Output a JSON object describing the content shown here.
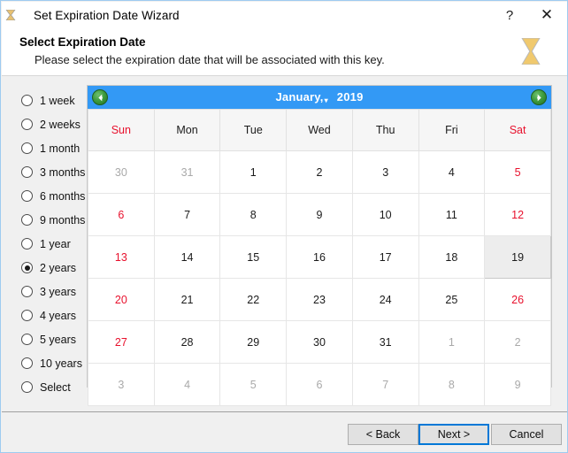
{
  "window": {
    "title": "Set Expiration Date Wizard",
    "title_icon": "hourglass-icon",
    "help_label": "?",
    "close_label": "✕",
    "border_color": "#9ecbf0",
    "background": "#f0f0f0"
  },
  "header": {
    "title": "Select Expiration Date",
    "subtitle": "Please select the expiration date that will be associated with this key.",
    "icon": "hourglass-icon"
  },
  "expiration_options": {
    "selected": "2 years",
    "items": [
      {
        "label": "1 week",
        "checked": false
      },
      {
        "label": "2 weeks",
        "checked": false
      },
      {
        "label": "1 month",
        "checked": false
      },
      {
        "label": "3 months",
        "checked": false
      },
      {
        "label": "6 months",
        "checked": false
      },
      {
        "label": "9 months",
        "checked": false
      },
      {
        "label": "1 year",
        "checked": false
      },
      {
        "label": "2 years",
        "checked": true
      },
      {
        "label": "3 years",
        "checked": false
      },
      {
        "label": "4 years",
        "checked": false
      },
      {
        "label": "5 years",
        "checked": false
      },
      {
        "label": "10 years",
        "checked": false
      },
      {
        "label": "Select",
        "checked": false
      }
    ]
  },
  "calendar": {
    "month_label": "January,",
    "year_label": "2019",
    "month": "January",
    "year": "2019",
    "prev_icon": "arrow-left-circle-icon",
    "next_icon": "arrow-right-circle-icon",
    "header_color": "#3399f5",
    "weekend_color": "#e8112d",
    "selected_day": "19",
    "selected_date": "2019-01-19",
    "weekdays": [
      {
        "label": "Sun",
        "weekend": true
      },
      {
        "label": "Mon",
        "weekend": false
      },
      {
        "label": "Tue",
        "weekend": false
      },
      {
        "label": "Wed",
        "weekend": false
      },
      {
        "label": "Thu",
        "weekend": false
      },
      {
        "label": "Fri",
        "weekend": false
      },
      {
        "label": "Sat",
        "weekend": true
      }
    ],
    "weeks": [
      [
        {
          "day": "30",
          "type": "other"
        },
        {
          "day": "31",
          "type": "other"
        },
        {
          "day": "1",
          "type": "normal"
        },
        {
          "day": "2",
          "type": "normal"
        },
        {
          "day": "3",
          "type": "normal"
        },
        {
          "day": "4",
          "type": "normal"
        },
        {
          "day": "5",
          "type": "weekend"
        }
      ],
      [
        {
          "day": "6",
          "type": "weekend"
        },
        {
          "day": "7",
          "type": "normal"
        },
        {
          "day": "8",
          "type": "normal"
        },
        {
          "day": "9",
          "type": "normal"
        },
        {
          "day": "10",
          "type": "normal"
        },
        {
          "day": "11",
          "type": "normal"
        },
        {
          "day": "12",
          "type": "weekend"
        }
      ],
      [
        {
          "day": "13",
          "type": "weekend"
        },
        {
          "day": "14",
          "type": "normal"
        },
        {
          "day": "15",
          "type": "normal"
        },
        {
          "day": "16",
          "type": "normal"
        },
        {
          "day": "17",
          "type": "normal"
        },
        {
          "day": "18",
          "type": "normal"
        },
        {
          "day": "19",
          "type": "selected"
        }
      ],
      [
        {
          "day": "20",
          "type": "weekend"
        },
        {
          "day": "21",
          "type": "normal"
        },
        {
          "day": "22",
          "type": "normal"
        },
        {
          "day": "23",
          "type": "normal"
        },
        {
          "day": "24",
          "type": "normal"
        },
        {
          "day": "25",
          "type": "normal"
        },
        {
          "day": "26",
          "type": "weekend"
        }
      ],
      [
        {
          "day": "27",
          "type": "weekend"
        },
        {
          "day": "28",
          "type": "normal"
        },
        {
          "day": "29",
          "type": "normal"
        },
        {
          "day": "30",
          "type": "normal"
        },
        {
          "day": "31",
          "type": "normal"
        },
        {
          "day": "1",
          "type": "other"
        },
        {
          "day": "2",
          "type": "other"
        }
      ],
      [
        {
          "day": "3",
          "type": "other"
        },
        {
          "day": "4",
          "type": "other"
        },
        {
          "day": "5",
          "type": "other"
        },
        {
          "day": "6",
          "type": "other"
        },
        {
          "day": "7",
          "type": "other"
        },
        {
          "day": "8",
          "type": "other"
        },
        {
          "day": "9",
          "type": "other"
        }
      ]
    ]
  },
  "footer": {
    "back_label": "< Back",
    "next_label": "Next >",
    "cancel_label": "Cancel",
    "default_button": "Next >",
    "focus_color": "#0078d7"
  }
}
